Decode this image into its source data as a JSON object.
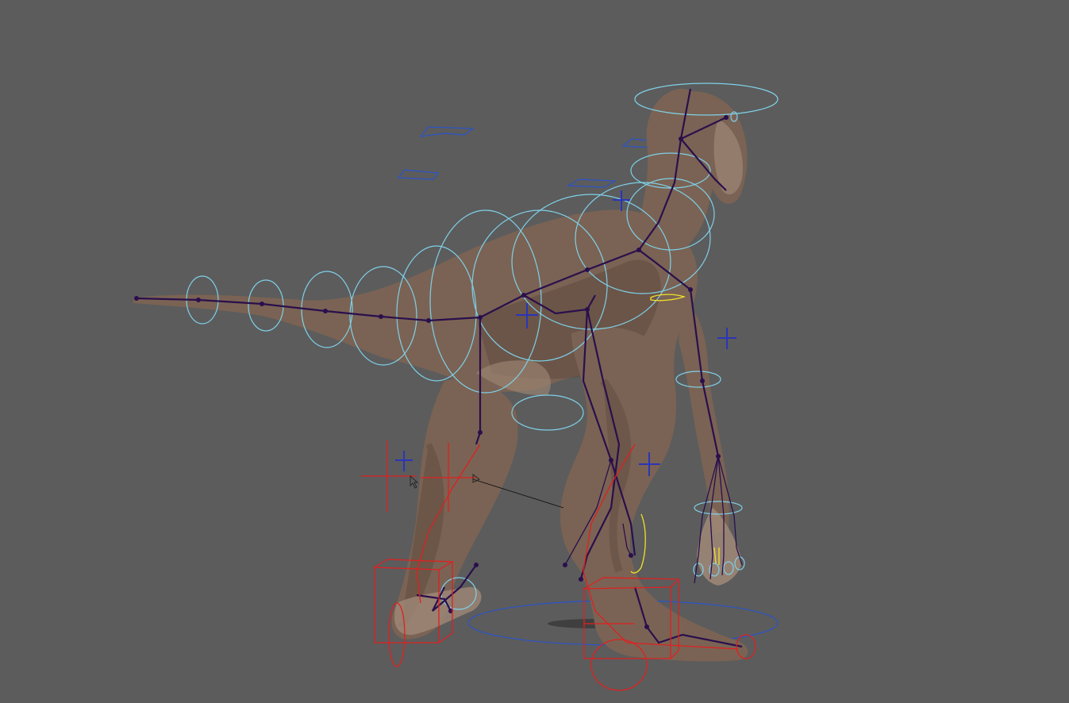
{
  "viewport": {
    "background": "#5c5c5c",
    "panel": "perspective-viewport"
  },
  "scene": {
    "subject": "raptor-rig",
    "colors": {
      "skin": "#7a6354",
      "joints": "#2a0f4d",
      "fk_controls": "#7fd0e8",
      "ik_controls": "#e02020",
      "ground_control": "#2b54c8",
      "selected_control": "#f0e02a",
      "locators": "#2a35b8"
    }
  }
}
